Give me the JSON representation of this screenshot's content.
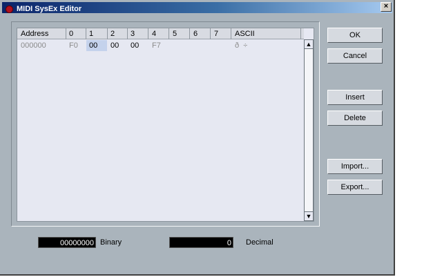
{
  "window": {
    "title": "MIDI SysEx Editor",
    "close_glyph": "×"
  },
  "table": {
    "columns": [
      "Address",
      "0",
      "1",
      "2",
      "3",
      "4",
      "5",
      "6",
      "7",
      "ASCII"
    ],
    "rows": [
      {
        "address": "000000",
        "bytes": [
          "F0",
          "00",
          "00",
          "00",
          "F7",
          "",
          "",
          ""
        ],
        "ascii": "ð  ÷"
      }
    ],
    "selected_cell": {
      "row": 0,
      "col": 1
    },
    "scroll_up_glyph": "▲",
    "scroll_down_glyph": "▼"
  },
  "buttons": {
    "ok": "OK",
    "cancel": "Cancel",
    "insert": "Insert",
    "delete": "Delete",
    "import": "Import...",
    "export": "Export..."
  },
  "fields": {
    "binary_value": "00000000",
    "binary_label": "Binary",
    "decimal_value": "0",
    "decimal_label": "Decimal"
  },
  "colors": {
    "title_bar_start": "#0a246a",
    "dialog_bg": "#aab4bc",
    "table_bg": "#e6e8f2",
    "selection": "#c4d2ec",
    "value_field_bg": "#000000"
  }
}
